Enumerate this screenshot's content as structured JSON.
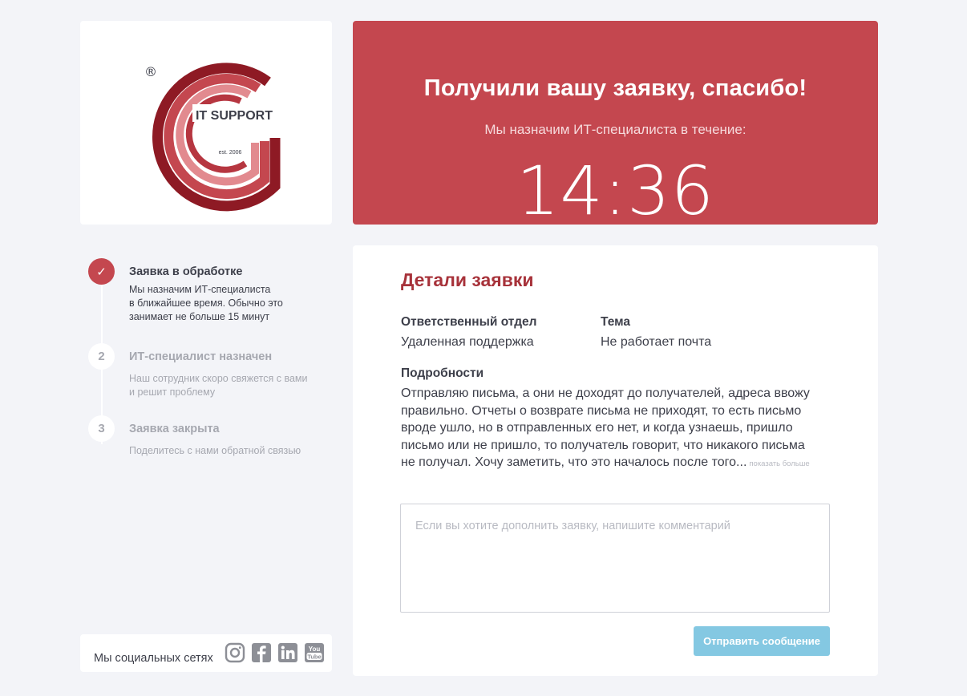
{
  "logo": {
    "brand_text": "IT SUPPORT",
    "est_text": "est. 2006",
    "registered_mark": "®"
  },
  "hero": {
    "title": "Получили вашу заявку, спасибо!",
    "subtitle": "Мы назначим ИТ-специалиста в течение:",
    "timer": "14:36"
  },
  "steps": [
    {
      "marker": "✓",
      "title": "Заявка в обработке",
      "description_lines": [
        "Мы назначим ИТ-специалиста",
        "в ближайшее время. Обычно это",
        "занимает не больше 15 минут"
      ],
      "state": "done"
    },
    {
      "marker": "2",
      "title": "ИТ-специалист назначен",
      "description_lines": [
        "Наш сотрудник скоро свяжется с вами",
        "и решит проблему"
      ],
      "state": "pending"
    },
    {
      "marker": "3",
      "title": "Заявка закрыта",
      "description_lines": [
        "Поделитесь с нами обратной связью"
      ],
      "state": "pending"
    }
  ],
  "social": {
    "label": "Мы социальных сетях",
    "icons": [
      "instagram-icon",
      "facebook-icon",
      "linkedin-icon",
      "youtube-icon"
    ],
    "youtube_text_top": "You",
    "youtube_text_bottom": "Tube"
  },
  "details": {
    "title": "Детали заявки",
    "department_label": "Ответственный отдел",
    "department_value": "Удаленная поддержка",
    "topic_label": "Тема",
    "topic_value": "Не работает почта",
    "description_label": "Подробности",
    "description_lines": [
      "Отправляю письма, а они не доходят до получателей, адреса ввожу",
      "правильно. Отчеты о возврате письма не приходят, то есть письмо",
      "вроде ушло, но в отправленных его нет, и когда узнаешь, пришло",
      "письмо или не пришло, то получатель говорит, что никакого письма",
      "не получал. Хочу заметить, что это началось после того..."
    ],
    "show_more": "показать больше",
    "comment_placeholder": "Если вы хотите дополнить заявку, напишите комментарий",
    "send_button": "Отправить сообщение"
  },
  "colors": {
    "accent_red": "#c4474f",
    "title_red": "#a7323a",
    "button_blue": "#84c8e2",
    "background": "#f3f4f8"
  }
}
